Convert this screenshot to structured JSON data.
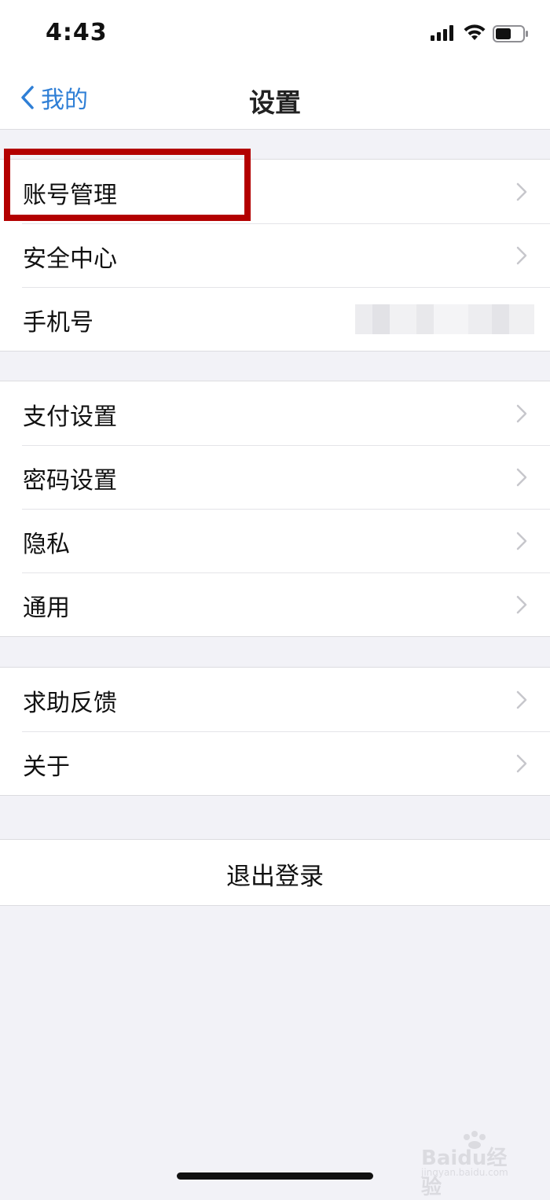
{
  "status_bar": {
    "time": "4:43",
    "icons": [
      "signal-icon",
      "wifi-icon",
      "battery-icon"
    ]
  },
  "nav": {
    "back_label": "我的",
    "title": "设置"
  },
  "groups": [
    {
      "items": [
        {
          "label": "账号管理"
        },
        {
          "label": "安全中心"
        },
        {
          "label": "手机号"
        }
      ]
    },
    {
      "items": [
        {
          "label": "支付设置"
        },
        {
          "label": "密码设置"
        },
        {
          "label": "隐私"
        },
        {
          "label": "通用"
        }
      ]
    },
    {
      "items": [
        {
          "label": "求助反馈"
        },
        {
          "label": "关于"
        }
      ]
    }
  ],
  "logout_label": "退出登录",
  "watermark": {
    "brand": "Baidu经验",
    "url": "jingyan.baidu.com"
  },
  "colors": {
    "accent": "#2f7fd6",
    "highlight": "#b30000",
    "background": "#f2f2f7"
  }
}
